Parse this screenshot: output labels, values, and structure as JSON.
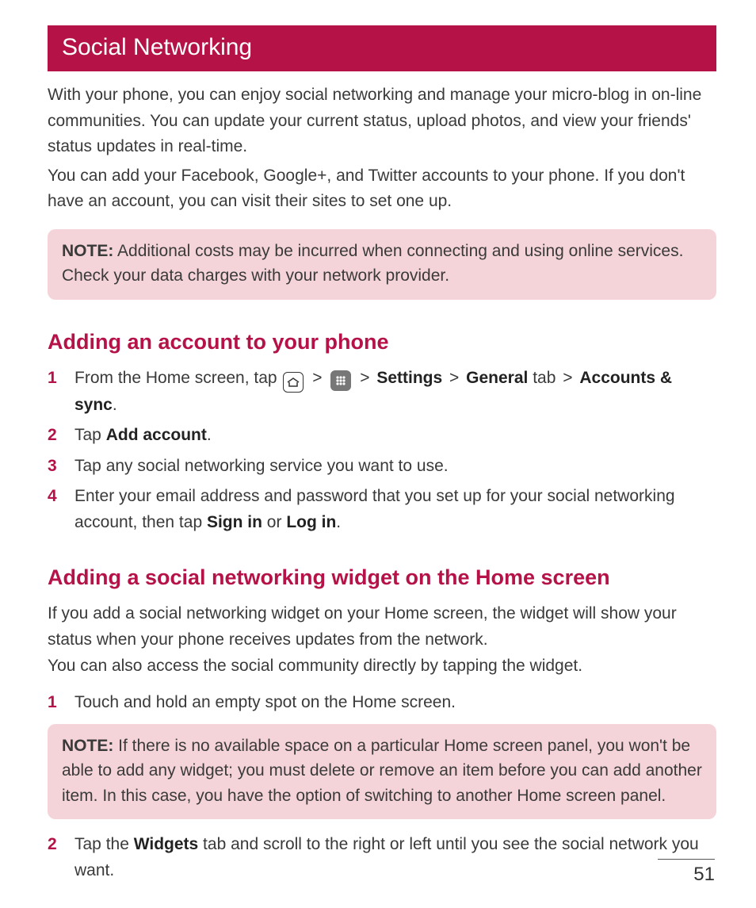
{
  "banner": "Social Networking",
  "intro": "With your phone, you can enjoy social networking and manage your micro-blog in on-line communities. You can update your current status, upload photos, and view your friends' status updates in real-time.",
  "intro2": "You can add your Facebook, Google+, and Twitter accounts to your phone. If you don't have an account, you can visit their sites to set one up.",
  "note1_label": "NOTE:",
  "note1_body": " Additional costs may be incurred when connecting and using online services. Check your data charges with your network provider.",
  "section1": "Adding an account to your phone",
  "s1_step1_pre": "From the Home screen, tap ",
  "s1_step1_settings": "Settings",
  "s1_step1_general": "General",
  "s1_step1_tab": " tab ",
  "s1_step1_accounts": "Accounts & sync",
  "s1_step2_pre": "Tap ",
  "s1_step2_b": "Add account",
  "s1_step3": "Tap any social networking service you want to use.",
  "s1_step4_pre": "Enter your email address and password that you set up for your social networking account, then tap ",
  "s1_step4_signin": "Sign in",
  "s1_step4_or": " or ",
  "s1_step4_login": "Log in",
  "section2": "Adding a social networking widget on the Home screen",
  "s2_intro": "If you add a social networking widget on your Home screen, the widget will show your status when your phone receives updates from the network.",
  "s2_intro2": "You can also access the social community directly by tapping the widget.",
  "s2_step1": "Touch and hold an empty spot on the Home screen.",
  "note2_label": "NOTE:",
  "note2_body": " If there is no available space on a particular Home screen panel, you won't be able to add any widget; you must delete or remove an item before you can add another item. In this case, you have the option of switching to another Home screen panel.",
  "s2_step2_pre": "Tap the ",
  "s2_step2_b": "Widgets",
  "s2_step2_post": " tab and scroll to the right or left until you see the social network you want.",
  "page": "51",
  "numbers": {
    "n1": "1",
    "n2": "2",
    "n3": "3",
    "n4": "4"
  },
  "gt": ">"
}
